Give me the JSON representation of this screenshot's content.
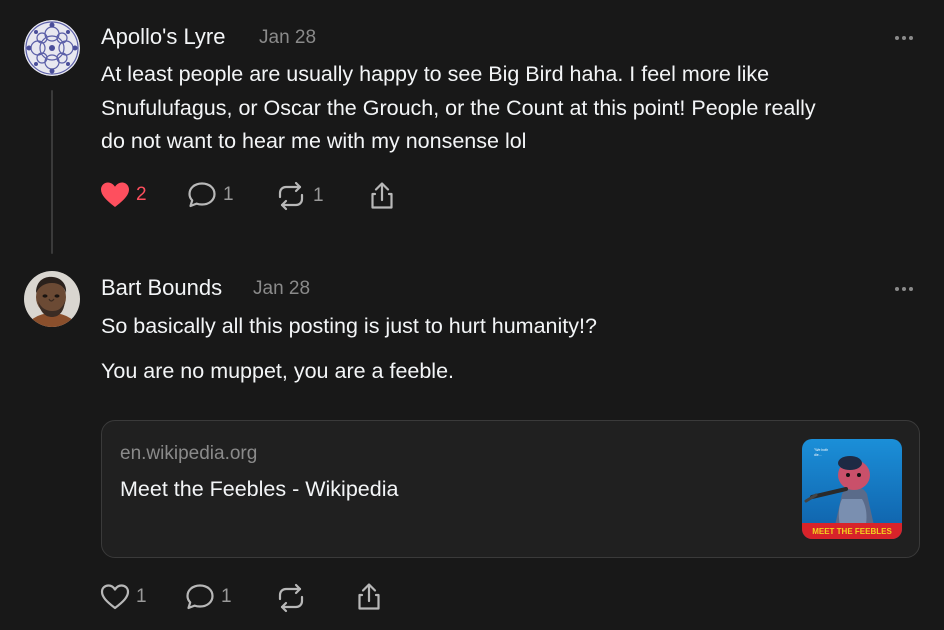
{
  "posts": [
    {
      "author": "Apollo's Lyre",
      "date": "Jan 28",
      "paragraphs": [
        "At least people are usually happy to see Big Bird haha. I feel more like",
        "Snufulufagus, or Oscar the Grouch, or the Count at this point! People really",
        "do not want to hear me with my nonsense lol"
      ],
      "likes": "2",
      "liked": true,
      "replies": "1",
      "reposts": "1"
    },
    {
      "author": "Bart Bounds",
      "date": "Jan 28",
      "paragraphs": [
        "So basically all this posting is just to hurt humanity!?",
        "You are no muppet, you are a feeble."
      ],
      "link": {
        "domain": "en.wikipedia.org",
        "title": "Meet the Feebles - Wikipedia",
        "thumb_text": "MEET THE FEEBLES"
      },
      "likes": "1",
      "liked": false,
      "replies": "1",
      "reposts": ""
    }
  ],
  "colors": {
    "background": "#181818",
    "text": "#f3f5f7",
    "muted": "#8a8a8a",
    "like_active": "#fe4f5e"
  },
  "icons": [
    "more-icon",
    "heart-icon",
    "comment-icon",
    "repost-icon",
    "share-icon"
  ]
}
